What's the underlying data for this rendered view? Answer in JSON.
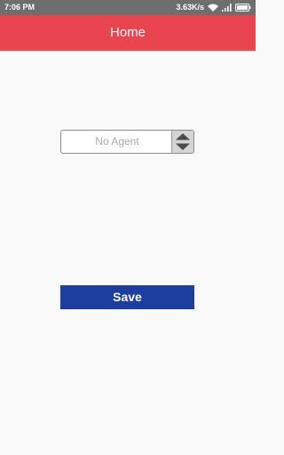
{
  "status_bar": {
    "time": "7:06 PM",
    "network_speed": "3.63K/s"
  },
  "app_bar": {
    "title": "Home"
  },
  "agent_spinner": {
    "selected_value": "No Agent"
  },
  "save_button": {
    "label": "Save"
  },
  "icons": {
    "status": [
      "signal-bars-icon",
      "wifi-icon",
      "battery-icon"
    ],
    "spinner": [
      "spinner-arrows-icon"
    ]
  },
  "colors": {
    "status_bar": "#6e6e6e",
    "app_bar": "#e84550",
    "save_button": "#1d3d9f",
    "background": "#f9f9f9"
  }
}
